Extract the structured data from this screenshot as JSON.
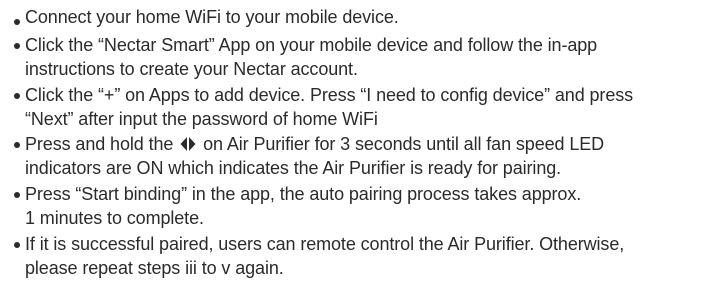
{
  "steps": [
    {
      "lines": [
        "Connect your home WiFi to your mobile device."
      ]
    },
    {
      "lines": [
        "Click the “Nectar Smart” App on your mobile device and follow the in-app",
        "instructions to create your Nectar account."
      ]
    },
    {
      "lines": [
        "Click the “+” on Apps to add device. Press “I need to config device” and press",
        "“Next” after input the password of home WiFi"
      ]
    },
    {
      "before_icon": "Press and hold the",
      "icon": "diamond-arrows-icon",
      "after_icon": "on Air Purifier for 3 seconds until all fan speed LED",
      "lines": [
        "indicators are ON which indicates the Air Purifier is ready for pairing."
      ]
    },
    {
      "lines": [
        "Press “Start binding” in the app, the auto pairing process takes approx.",
        "1 minutes to complete."
      ]
    },
    {
      "lines": [
        "If it is successful paired, users can remote control the Air Purifier. Otherwise,",
        "please repeat steps iii to v again."
      ]
    }
  ]
}
